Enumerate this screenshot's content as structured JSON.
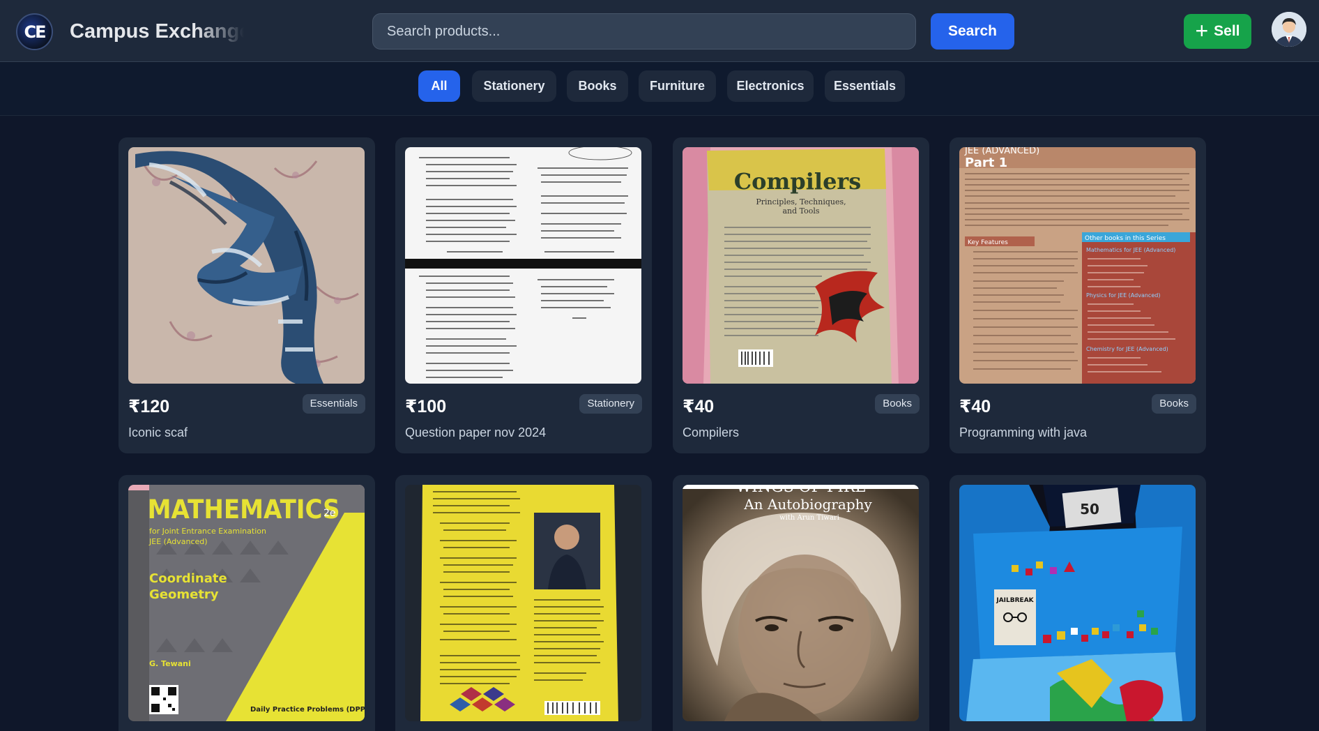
{
  "header": {
    "logo_text": "CE",
    "brand": "Campus Exchange",
    "search_placeholder": "Search products...",
    "search_label": "Search",
    "sell_label": "Sell"
  },
  "filters": [
    "All",
    "Stationery",
    "Books",
    "Furniture",
    "Electronics",
    "Essentials"
  ],
  "active_filter": "All",
  "products": [
    {
      "price": "₹120",
      "category": "Essentials",
      "title": "Iconic scaf"
    },
    {
      "price": "₹100",
      "category": "Stationery",
      "title": "Question paper nov 2024"
    },
    {
      "price": "₹40",
      "category": "Books",
      "title": "Compilers"
    },
    {
      "price": "₹40",
      "category": "Books",
      "title": "Programming with java"
    },
    {
      "price": "",
      "category": "",
      "title": ""
    },
    {
      "price": "",
      "category": "",
      "title": ""
    },
    {
      "price": "",
      "category": "",
      "title": ""
    },
    {
      "price": "",
      "category": "",
      "title": ""
    }
  ],
  "images": {
    "compilers": {
      "title": "Compilers",
      "subtitle": "Principles, Techniques,",
      "subtitle2": "and Tools"
    },
    "jee_part": {
      "heading": "JEE (ADVANCED)",
      "part": "Part 1",
      "key_features": "Key Features",
      "other_books": "Other books in this Series",
      "series": [
        "Mathematics for JEE (Advanced)",
        "Physics for JEE (Advanced)",
        "Chemistry for JEE (Advanced)"
      ]
    },
    "maths": {
      "title": "MATHEMATICS",
      "edition": "2e",
      "sub1": "for Joint Entrance Examination",
      "sub2": "JEE (Advanced)",
      "topic1": "Coordinate",
      "topic2": "Geometry",
      "author": "G. Tewani",
      "dpp": "Daily Practice Problems (DPP)"
    },
    "wings": {
      "title": "WINGS OF FIRE",
      "subtitle": "An Autobiography",
      "author": "with Arun Tiwari"
    },
    "jailbreak": {
      "label": "JAILBREAK",
      "note": "50"
    }
  },
  "colors": {
    "accent": "#2563eb",
    "sell": "#16a34a",
    "background": "#0f172a",
    "card": "#1e293b"
  }
}
